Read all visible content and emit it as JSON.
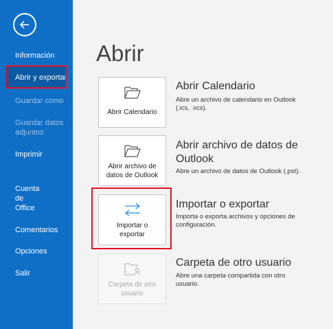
{
  "sidebar": {
    "back_icon": "back-arrow-icon",
    "items": [
      {
        "label": "Información"
      },
      {
        "label": "Abrir y exportar"
      },
      {
        "label": "Guardar como"
      },
      {
        "label": "Guardar datos adjuntos"
      },
      {
        "label": "Imprimir"
      },
      {
        "label": "Cuenta de Office"
      },
      {
        "label": "Comentarios"
      },
      {
        "label": "Opciones"
      },
      {
        "label": "Salir"
      }
    ],
    "colors": {
      "background": "#0f6fc6",
      "selected": "#0b5aa3",
      "disabled_text": "#9cc2e8"
    }
  },
  "main": {
    "title": "Abrir",
    "options": [
      {
        "tile_label": "Abrir Calendario",
        "title": "Abrir Calendario",
        "description": "Abre un archivo de calendario en Outlook (.ics, .vcs).",
        "icon": "folder-open-icon"
      },
      {
        "tile_label": "Abrir archivo de datos de Outlook",
        "title": "Abrir archivo de datos de Outlook",
        "description": "Abre un archivo de datos de Outlook (.pst).",
        "icon": "folder-open-icon"
      },
      {
        "tile_label": "Importar o exportar",
        "title": "Importar o exportar",
        "description": "Importa o exporta archivos y opciones de configuración.",
        "icon": "import-export-arrows-icon"
      },
      {
        "tile_label": "Carpeta de otro usuario",
        "title": "Carpeta de otro usuario",
        "description": "Abre una carpeta compartida con otro usuario.",
        "icon": "shared-folder-user-icon"
      }
    ]
  },
  "highlight_color": "#e81123"
}
